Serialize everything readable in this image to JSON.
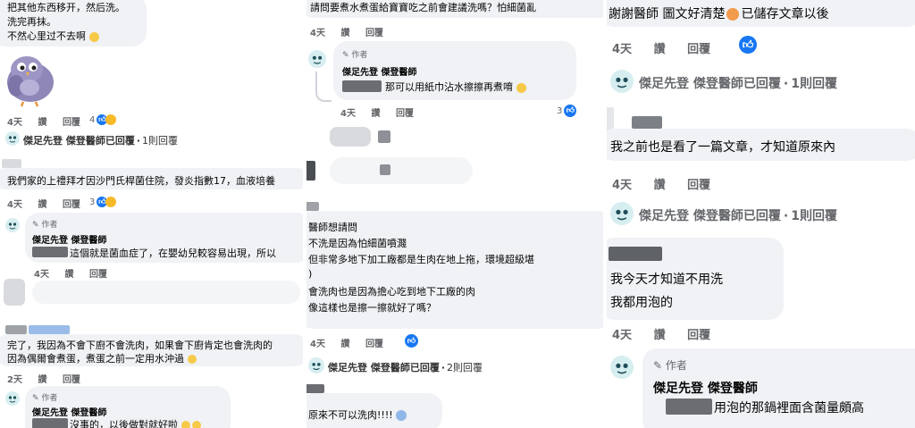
{
  "col1": {
    "c1_line1": "把其他东西移开，然后洗。",
    "c1_line2": "洗完再抹。",
    "c1_line3": "不然心里过不去啊",
    "c1_actions": {
      "time": "4天",
      "like": "讚",
      "reply": "回覆",
      "count": "4"
    },
    "c1_replied": {
      "name": "傑足先登 傑登醫師已回覆",
      "sep": "·",
      "count": "1則回覆"
    },
    "c2_text": "我們家的上禮拜才因沙門氏桿菌住院，發炎指數17，血液培養",
    "c2_actions": {
      "time": "4天",
      "like": "讚",
      "reply": "回覆",
      "count": "3"
    },
    "r1_author_tag": "作者",
    "r1_name": "傑足先登 傑登醫師",
    "r1_text": "這個就是菌血症了，在嬰幼兒較容易出現，所以",
    "r1_actions": {
      "time": "4天",
      "like": "讚",
      "reply": "回覆"
    },
    "c3_line1": "完了，我因為不會下廚不會洗肉，如果會下廚肯定也會洗肉的",
    "c3_line2": "因為偶爾會煮蛋，煮蛋之前一定用水沖過",
    "c3_actions": {
      "time": "2天",
      "like": "讚",
      "reply": "回覆"
    },
    "r2_author_tag": "作者",
    "r2_name": "傑足先登 傑登醫師",
    "r2_text": "沒事的，以後做對就好啦"
  },
  "col2": {
    "c1_text": "請問要煮水煮蛋給寶寶吃之前會建議洗嗎？怕細菌亂",
    "c1_actions": {
      "time": "4天",
      "like": "讚",
      "reply": "回覆"
    },
    "r1_author_tag": "作者",
    "r1_name": "傑足先登 傑登醫師",
    "r1_text": "那可以用紙巾沾水擦擦再煮唷",
    "r1_actions": {
      "time": "4天",
      "like": "讚",
      "reply": "回覆",
      "count": "3"
    },
    "c2_line1": "醫師想請問",
    "c2_line2": "不洗是因為怕細菌噴濺",
    "c2_line3": "但非常多地下加工廠都是生肉在地上拖，環境超級堪",
    "c2_line4": ")",
    "c2_line5": "會洗肉也是因為擔心吃到地下工廠的肉",
    "c2_line6": "像這樣也是擦一擦就好了嗎？",
    "c2_actions": {
      "time": "4天",
      "like": "讚",
      "reply": "回覆"
    },
    "c2_replied": {
      "name": "傑足先登 傑登醫師已回覆",
      "sep": "·",
      "count": "2則回覆"
    },
    "c3_text": "原來不可以洗肉!!!!"
  },
  "col3": {
    "c1_text": "謝謝醫師 圖文好清楚",
    "c1_text2": "已儲存文章以後",
    "c1_actions": {
      "time": "4天",
      "like": "讚",
      "reply": "回覆"
    },
    "c1_replied": {
      "name": "傑足先登 傑登醫師已回覆",
      "sep": "·",
      "count": "1則回覆"
    },
    "c2_text": "我之前也是看了一篇文章，才知道原來內",
    "c2_actions": {
      "time": "4天",
      "like": "讚",
      "reply": "回覆"
    },
    "c2_replied": {
      "name": "傑足先登 傑登醫師已回覆",
      "sep": "·",
      "count": "1則回覆"
    },
    "c3_line1": "我今天才知道不用洗",
    "c3_line2": "我都用泡的",
    "c3_actions": {
      "time": "4天",
      "like": "讚",
      "reply": "回覆"
    },
    "r1_author_tag": "作者",
    "r1_name": "傑足先登 傑登醫師",
    "r1_text": "用泡的那鍋裡面含菌量頗高"
  },
  "colors": {
    "like_blue": "#1877f2",
    "meta_gray": "#65676b",
    "bubble_bg": "#f0f2f5",
    "redacted": "#6b6d72"
  }
}
